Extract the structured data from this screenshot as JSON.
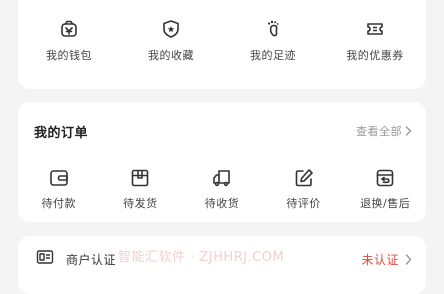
{
  "quick_links": [
    {
      "label": "我的钱包",
      "icon": "wallet-icon"
    },
    {
      "label": "我的收藏",
      "icon": "favorites-shield-icon"
    },
    {
      "label": "我的足迹",
      "icon": "footprint-icon"
    },
    {
      "label": "我的优惠券",
      "icon": "coupon-icon"
    }
  ],
  "orders": {
    "title": "我的订单",
    "view_all": "查看全部",
    "items": [
      {
        "label": "待付款",
        "icon": "wallet-card-icon"
      },
      {
        "label": "待发货",
        "icon": "box-icon"
      },
      {
        "label": "待收货",
        "icon": "truck-icon"
      },
      {
        "label": "待评价",
        "icon": "edit-icon"
      },
      {
        "label": "退换/售后",
        "icon": "return-icon"
      }
    ]
  },
  "merchant": {
    "label": "商户认证",
    "status": "未认证",
    "icon": "id-card-icon"
  },
  "watermark": "智能汇软件 · ZJHHRJ.COM",
  "colors": {
    "background": "#f4f4f4",
    "card": "#ffffff",
    "status_red": "#e24b3c",
    "muted_text": "#999999"
  }
}
